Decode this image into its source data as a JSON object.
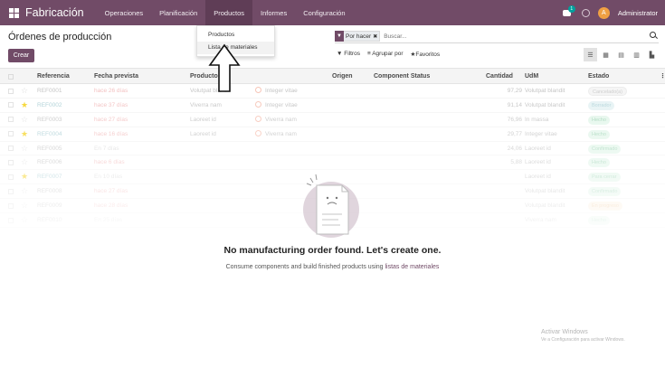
{
  "app": {
    "name": "Fabricación",
    "menu": [
      "Operaciones",
      "Planificación",
      "Productos",
      "Informes",
      "Configuración"
    ],
    "chat_badge": "1",
    "user": "Administrator",
    "user_initial": "A"
  },
  "dropdown": {
    "items": [
      "Productos",
      "Lista de materiales"
    ]
  },
  "page": {
    "title": "Órdenes de producción",
    "create_label": "Crear"
  },
  "search": {
    "facet_label": "Por hacer",
    "placeholder": "Buscar..."
  },
  "filters": {
    "filters_label": "Filtros",
    "group_label": "Agrupar por",
    "favorites_label": "Favoritos"
  },
  "table": {
    "columns": [
      "Referencia",
      "Fecha prevista",
      "Producto",
      "",
      "Origen",
      "Component Status",
      "Cantidad",
      "UdM",
      "Estado"
    ],
    "rows": [
      {
        "ref": "REF0001",
        "date": "hace 26 días",
        "product": "Volutpat blandit",
        "component": "Integer vitae",
        "qty": "97,29",
        "uom": "Volutpat blandit",
        "status": "Cancelado(a)",
        "fav": false
      },
      {
        "ref": "REF0002",
        "date": "hace 37 días",
        "product": "Viverra nam",
        "component": "Integer vitae",
        "qty": "91,14",
        "uom": "Volutpat blandit",
        "status": "Borrador",
        "fav": true
      },
      {
        "ref": "REF0003",
        "date": "hace 27 días",
        "product": "Laoreet id",
        "component": "Viverra nam",
        "qty": "76,96",
        "uom": "In massa",
        "status": "Hecho",
        "fav": false
      },
      {
        "ref": "REF0004",
        "date": "hace 16 días",
        "product": "Laoreet id",
        "component": "Viverra nam",
        "qty": "29,77",
        "uom": "Integer vitae",
        "status": "Hecho",
        "fav": true
      },
      {
        "ref": "REF0005",
        "date": "En 7 días",
        "product": "",
        "component": "",
        "qty": "24,06",
        "uom": "Laoreet id",
        "status": "Confirmado",
        "fav": false
      },
      {
        "ref": "REF0006",
        "date": "hace 6 días",
        "product": "",
        "component": "",
        "qty": "5,88",
        "uom": "Laoreet id",
        "status": "Hecho",
        "fav": false
      },
      {
        "ref": "REF0007",
        "date": "En 10 días",
        "product": "",
        "component": "",
        "qty": "",
        "uom": "Laoreet id",
        "status": "Para cerrar",
        "fav": true
      },
      {
        "ref": "REF0008",
        "date": "hace 27 días",
        "product": "",
        "component": "",
        "qty": "",
        "uom": "Volutpat blandit",
        "status": "Confirmado",
        "fav": false
      },
      {
        "ref": "REF0009",
        "date": "hace 28 días",
        "product": "",
        "component": "",
        "qty": "",
        "uom": "Volutpat blandit",
        "status": "En progreso",
        "fav": false
      },
      {
        "ref": "REF0010",
        "date": "En 25 días",
        "product": "",
        "component": "",
        "qty": "",
        "uom": "Viverra nam",
        "status": "Hecho",
        "fav": false
      }
    ]
  },
  "empty_state": {
    "title": "No manufacturing order found. Let's create one.",
    "help_prefix": "Consume components and build finished products using ",
    "help_link": "listas de materiales"
  },
  "watermark": {
    "line1": "Activar Windows",
    "line2": "Ve a Configuración para activar Windows."
  },
  "colors": {
    "brand": "#714b67",
    "link": "#9bc6cd",
    "late": "#f0b3b3"
  }
}
